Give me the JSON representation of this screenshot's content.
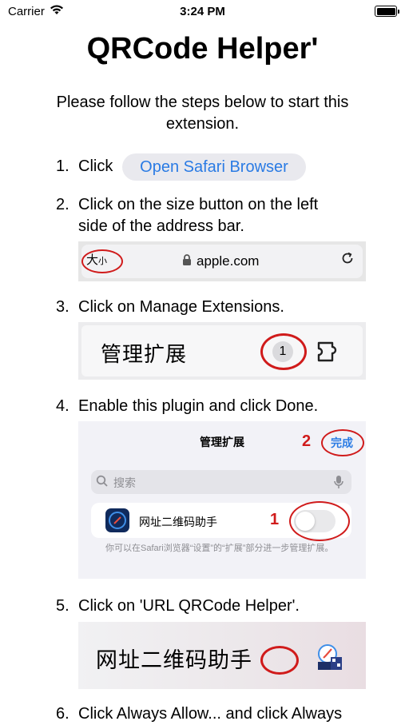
{
  "status_bar": {
    "carrier": "Carrier",
    "time": "3:24 PM"
  },
  "title": "QRCode Helper'",
  "intro": "Please follow the steps below to start this extension.",
  "steps": [
    {
      "num": "1.",
      "text": "Click",
      "button": "Open Safari Browser"
    },
    {
      "num": "2.",
      "text": "Click on the size button on the left side of the address bar."
    },
    {
      "num": "3.",
      "text": "Click on Manage Extensions."
    },
    {
      "num": "4.",
      "text": "Enable this plugin and click Done."
    },
    {
      "num": "5.",
      "text": "Click on 'URL QRCode Helper'."
    },
    {
      "num": "6.",
      "text": "Click Always Allow... and click Always"
    }
  ],
  "shot_address_bar": {
    "size_label_big": "大",
    "size_label_small": "小",
    "url": "apple.com"
  },
  "shot_manage": {
    "label": "管理扩展",
    "badge": "1"
  },
  "shot_enable": {
    "header": "管理扩展",
    "marker_done": "2",
    "done": "完成",
    "search_placeholder": "搜索",
    "app_name": "网址二维码助手",
    "marker_toggle": "1",
    "note": "你可以在Safari浏览器“设置”的“扩展”部分进一步管理扩展。",
    "toggle_on": false
  },
  "shot_helper": {
    "label": "网址二维码助手"
  },
  "colors": {
    "accent": "#2a7be4",
    "annotation": "#d01b1b"
  }
}
